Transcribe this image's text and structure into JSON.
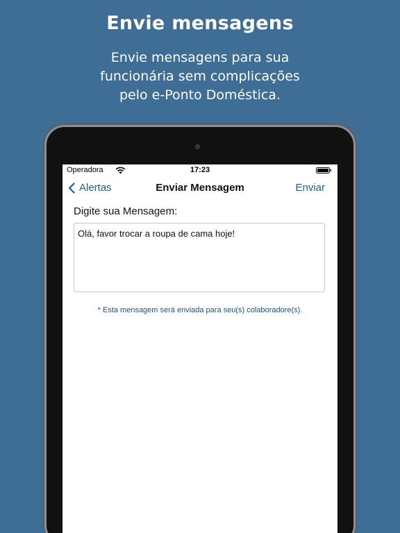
{
  "promo": {
    "title": "Envie mensagens",
    "subtitle_lines": [
      "Envie mensagens para sua",
      "funcionária sem complicações",
      "pelo e-Ponto Doméstica."
    ]
  },
  "status_bar": {
    "carrier": "Operadora",
    "time": "17:23"
  },
  "nav": {
    "back_label": "Alertas",
    "title": "Enviar Mensagem",
    "send_label": "Enviar"
  },
  "form": {
    "label": "Digite sua Mensagem:",
    "message_value": "Olá, favor trocar a roupa de cama hoje!",
    "note": "* Esta mensagem será enviada para seu(s) colaboradore(s)."
  },
  "icons": {
    "back": "chevron-left-icon",
    "wifi": "wifi-icon",
    "battery": "battery-icon"
  },
  "colors": {
    "background": "#3e6e95",
    "accent": "#1f5d8f",
    "note_text": "#1f4f82"
  }
}
